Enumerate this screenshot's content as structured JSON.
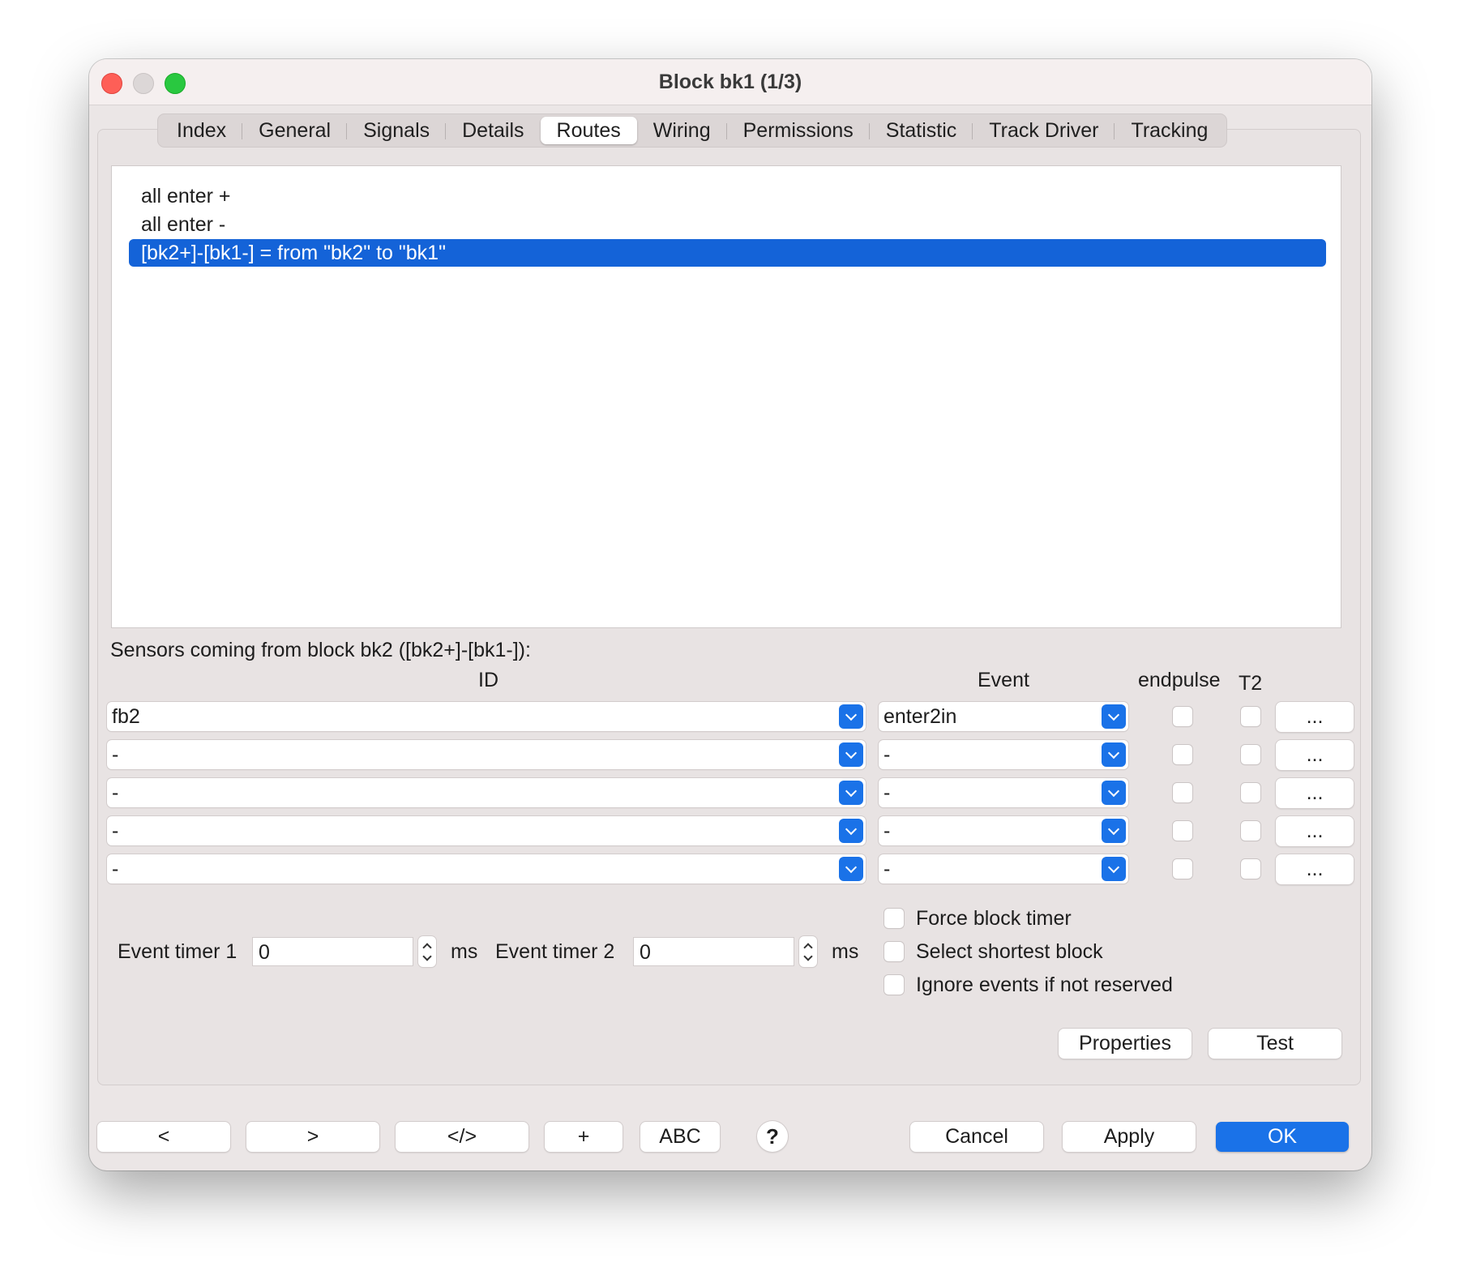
{
  "window": {
    "title": "Block bk1 (1/3)"
  },
  "tabs": [
    {
      "label": "Index"
    },
    {
      "label": "General"
    },
    {
      "label": "Signals"
    },
    {
      "label": "Details"
    },
    {
      "label": "Routes",
      "active": true
    },
    {
      "label": "Wiring"
    },
    {
      "label": "Permissions"
    },
    {
      "label": "Statistic"
    },
    {
      "label": "Track Driver"
    },
    {
      "label": "Tracking"
    }
  ],
  "routes": {
    "items": [
      "all enter +",
      "all enter -",
      "[bk2+]-[bk1-] = from \"bk2\" to \"bk1\""
    ],
    "selected_index": 2
  },
  "sensors": {
    "heading": "Sensors coming from block bk2 ([bk2+]-[bk1-]):",
    "columns": {
      "id": "ID",
      "event": "Event",
      "endpulse": "endpulse",
      "t2": "T2"
    },
    "rows": [
      {
        "id": "fb2",
        "event": "enter2in",
        "endpulse": false,
        "t2": false,
        "more": "..."
      },
      {
        "id": "-",
        "event": "-",
        "endpulse": false,
        "t2": false,
        "more": "..."
      },
      {
        "id": "-",
        "event": "-",
        "endpulse": false,
        "t2": false,
        "more": "..."
      },
      {
        "id": "-",
        "event": "-",
        "endpulse": false,
        "t2": false,
        "more": "..."
      },
      {
        "id": "-",
        "event": "-",
        "endpulse": false,
        "t2": false,
        "more": "..."
      }
    ]
  },
  "timers": {
    "timer1_label": "Event timer 1",
    "timer1_value": "0",
    "timer1_unit": "ms",
    "timer2_label": "Event timer 2",
    "timer2_value": "0",
    "timer2_unit": "ms"
  },
  "options": {
    "force_block_timer": "Force block timer",
    "select_shortest_block": "Select shortest block",
    "ignore_events": "Ignore events if not reserved"
  },
  "panel_buttons": {
    "properties": "Properties",
    "test": "Test"
  },
  "footer": {
    "prev": "<",
    "next": ">",
    "xml": "</>",
    "add": "+",
    "abc": "ABC",
    "help": "?",
    "cancel": "Cancel",
    "apply": "Apply",
    "ok": "OK"
  },
  "colors": {
    "accent": "#1a72e8",
    "selection": "#1463d8",
    "window_bg": "#ebe6e6"
  }
}
